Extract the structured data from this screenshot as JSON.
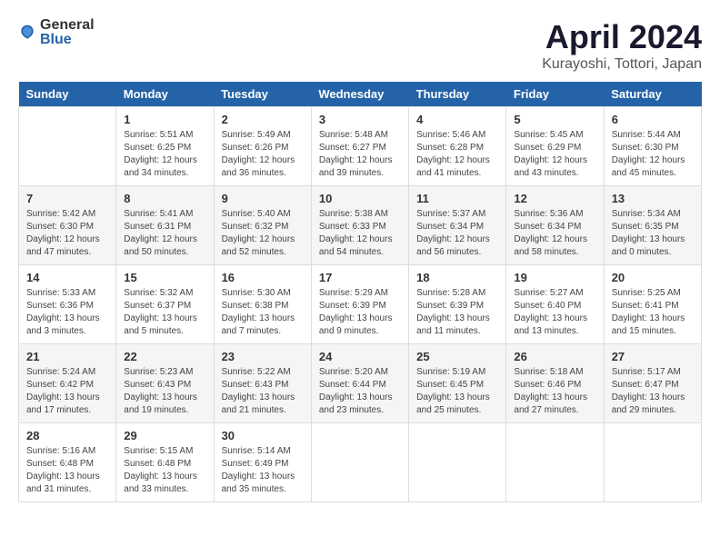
{
  "header": {
    "logo_general": "General",
    "logo_blue": "Blue",
    "title": "April 2024",
    "subtitle": "Kurayoshi, Tottori, Japan"
  },
  "calendar": {
    "weekdays": [
      "Sunday",
      "Monday",
      "Tuesday",
      "Wednesday",
      "Thursday",
      "Friday",
      "Saturday"
    ],
    "weeks": [
      [
        {
          "day": "",
          "info": ""
        },
        {
          "day": "1",
          "info": "Sunrise: 5:51 AM\nSunset: 6:25 PM\nDaylight: 12 hours\nand 34 minutes."
        },
        {
          "day": "2",
          "info": "Sunrise: 5:49 AM\nSunset: 6:26 PM\nDaylight: 12 hours\nand 36 minutes."
        },
        {
          "day": "3",
          "info": "Sunrise: 5:48 AM\nSunset: 6:27 PM\nDaylight: 12 hours\nand 39 minutes."
        },
        {
          "day": "4",
          "info": "Sunrise: 5:46 AM\nSunset: 6:28 PM\nDaylight: 12 hours\nand 41 minutes."
        },
        {
          "day": "5",
          "info": "Sunrise: 5:45 AM\nSunset: 6:29 PM\nDaylight: 12 hours\nand 43 minutes."
        },
        {
          "day": "6",
          "info": "Sunrise: 5:44 AM\nSunset: 6:30 PM\nDaylight: 12 hours\nand 45 minutes."
        }
      ],
      [
        {
          "day": "7",
          "info": "Sunrise: 5:42 AM\nSunset: 6:30 PM\nDaylight: 12 hours\nand 47 minutes."
        },
        {
          "day": "8",
          "info": "Sunrise: 5:41 AM\nSunset: 6:31 PM\nDaylight: 12 hours\nand 50 minutes."
        },
        {
          "day": "9",
          "info": "Sunrise: 5:40 AM\nSunset: 6:32 PM\nDaylight: 12 hours\nand 52 minutes."
        },
        {
          "day": "10",
          "info": "Sunrise: 5:38 AM\nSunset: 6:33 PM\nDaylight: 12 hours\nand 54 minutes."
        },
        {
          "day": "11",
          "info": "Sunrise: 5:37 AM\nSunset: 6:34 PM\nDaylight: 12 hours\nand 56 minutes."
        },
        {
          "day": "12",
          "info": "Sunrise: 5:36 AM\nSunset: 6:34 PM\nDaylight: 12 hours\nand 58 minutes."
        },
        {
          "day": "13",
          "info": "Sunrise: 5:34 AM\nSunset: 6:35 PM\nDaylight: 13 hours\nand 0 minutes."
        }
      ],
      [
        {
          "day": "14",
          "info": "Sunrise: 5:33 AM\nSunset: 6:36 PM\nDaylight: 13 hours\nand 3 minutes."
        },
        {
          "day": "15",
          "info": "Sunrise: 5:32 AM\nSunset: 6:37 PM\nDaylight: 13 hours\nand 5 minutes."
        },
        {
          "day": "16",
          "info": "Sunrise: 5:30 AM\nSunset: 6:38 PM\nDaylight: 13 hours\nand 7 minutes."
        },
        {
          "day": "17",
          "info": "Sunrise: 5:29 AM\nSunset: 6:39 PM\nDaylight: 13 hours\nand 9 minutes."
        },
        {
          "day": "18",
          "info": "Sunrise: 5:28 AM\nSunset: 6:39 PM\nDaylight: 13 hours\nand 11 minutes."
        },
        {
          "day": "19",
          "info": "Sunrise: 5:27 AM\nSunset: 6:40 PM\nDaylight: 13 hours\nand 13 minutes."
        },
        {
          "day": "20",
          "info": "Sunrise: 5:25 AM\nSunset: 6:41 PM\nDaylight: 13 hours\nand 15 minutes."
        }
      ],
      [
        {
          "day": "21",
          "info": "Sunrise: 5:24 AM\nSunset: 6:42 PM\nDaylight: 13 hours\nand 17 minutes."
        },
        {
          "day": "22",
          "info": "Sunrise: 5:23 AM\nSunset: 6:43 PM\nDaylight: 13 hours\nand 19 minutes."
        },
        {
          "day": "23",
          "info": "Sunrise: 5:22 AM\nSunset: 6:43 PM\nDaylight: 13 hours\nand 21 minutes."
        },
        {
          "day": "24",
          "info": "Sunrise: 5:20 AM\nSunset: 6:44 PM\nDaylight: 13 hours\nand 23 minutes."
        },
        {
          "day": "25",
          "info": "Sunrise: 5:19 AM\nSunset: 6:45 PM\nDaylight: 13 hours\nand 25 minutes."
        },
        {
          "day": "26",
          "info": "Sunrise: 5:18 AM\nSunset: 6:46 PM\nDaylight: 13 hours\nand 27 minutes."
        },
        {
          "day": "27",
          "info": "Sunrise: 5:17 AM\nSunset: 6:47 PM\nDaylight: 13 hours\nand 29 minutes."
        }
      ],
      [
        {
          "day": "28",
          "info": "Sunrise: 5:16 AM\nSunset: 6:48 PM\nDaylight: 13 hours\nand 31 minutes."
        },
        {
          "day": "29",
          "info": "Sunrise: 5:15 AM\nSunset: 6:48 PM\nDaylight: 13 hours\nand 33 minutes."
        },
        {
          "day": "30",
          "info": "Sunrise: 5:14 AM\nSunset: 6:49 PM\nDaylight: 13 hours\nand 35 minutes."
        },
        {
          "day": "",
          "info": ""
        },
        {
          "day": "",
          "info": ""
        },
        {
          "day": "",
          "info": ""
        },
        {
          "day": "",
          "info": ""
        }
      ]
    ]
  }
}
